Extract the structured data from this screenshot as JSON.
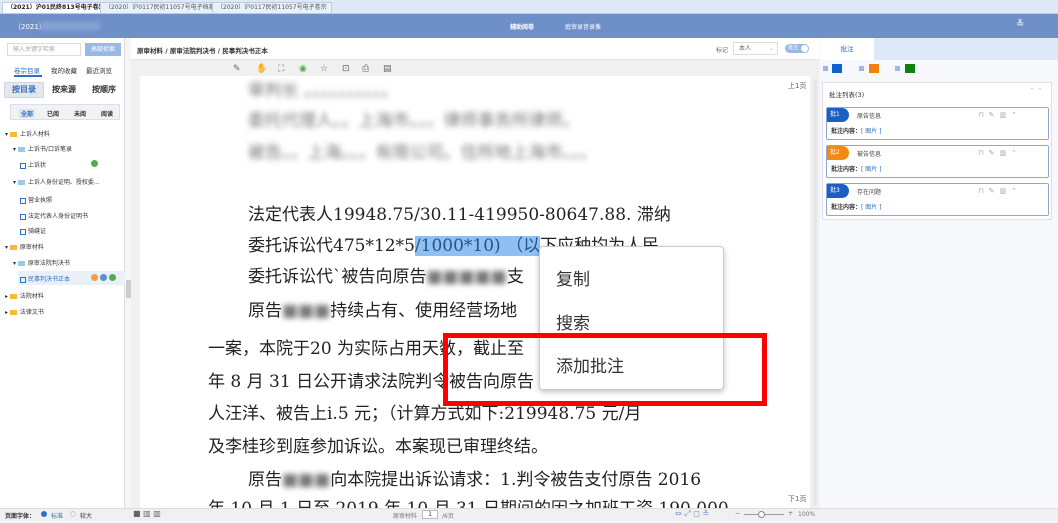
{
  "file_tabs": [
    "（2021）沪01民终813号电子卷宗",
    "（2020）沪0117民初11057号电子档案",
    "（2020）沪0117民初11057号电子卷宗"
  ],
  "header": {
    "case": "（2021）",
    "nav": [
      "辅助阅卷",
      "庭审录音录像"
    ]
  },
  "left": {
    "search_placeholder": "输入关键字检索",
    "search_button": "高级检索",
    "tabs": [
      "卷宗目录",
      "我的收藏",
      "最近浏览"
    ],
    "sort_tabs": [
      "按目录",
      "按来源",
      "按顺序"
    ],
    "filters": [
      "全部",
      "已阅",
      "未阅",
      "阅读"
    ],
    "tree": [
      {
        "label": "上诉人材料",
        "level": 0,
        "type": "folder"
      },
      {
        "label": "上诉书/口诉笔录",
        "level": 1,
        "type": "subfolder"
      },
      {
        "label": "上诉状",
        "level": 2,
        "type": "file"
      },
      {
        "label": "上诉人身份证明、授权委...",
        "level": 1,
        "type": "subfolder"
      },
      {
        "label": "营业执照",
        "level": 2,
        "type": "file"
      },
      {
        "label": "法定代表人身份证明书",
        "level": 2,
        "type": "file"
      },
      {
        "label": "骑缝证",
        "level": 2,
        "type": "file"
      },
      {
        "label": "原审材料",
        "level": 0,
        "type": "folder"
      },
      {
        "label": "原审法院判决书",
        "level": 1,
        "type": "subfolder"
      },
      {
        "label": "民事判决书正本",
        "level": 2,
        "type": "file"
      },
      {
        "label": "法院材料",
        "level": 0,
        "type": "folder"
      },
      {
        "label": "法律文书",
        "level": 0,
        "type": "folder"
      }
    ]
  },
  "doc": {
    "breadcrumb": "原审材料 / 原审法院判决书 / 民事判决书正本",
    "mark_label": "标记",
    "mark_select": "本人",
    "toggle_label": "批注",
    "prev_page": "上1页",
    "next_page": "下1页",
    "lines": {
      "b1": "审判长 。。。。。。。。。。",
      "b2": "委托代理人。。上海市。。。律师事务所律师。",
      "b3": "被告。。上海。。。有限公司。住所地上海市。。。",
      "l1": "法定代表人19948.75/30.11-419950-80647.88. 滞纳",
      "l2a": "委托诉讼代475*12*5",
      "l2h": "/1000*10) （以",
      "l2b": "下应种均为人民",
      "l3a": "委托诉讼代`被告向原告",
      "l3b": "支",
      "l4a": "原告",
      "l4b": "持续占有、使用经营场地",
      "l5": "一案，本院于20 为实际占用天数，截止至",
      "l6": "年 8 月 31 日公开请求法院判令被告向原告",
      "l7": "人汪洋、被告上i.5 元；（计算方式如下:219948.75 元/月",
      "l8": "及李桂珍到庭参加诉讼。本案现已审理终结。",
      "l9a": "原告",
      "l9b": "向本院提出诉讼请求：1.判令被告支付原告 2016",
      "l10": "年 10 月 1 日至 2019 年 10 月 31 日期间的因之加班工资 190,000"
    }
  },
  "context_menu": [
    "复制",
    "搜索",
    "添加批注"
  ],
  "right": {
    "tab": "批注",
    "list_title": "批注列表(3)",
    "colors": [
      "#1060d0",
      "#f08010",
      "#108010"
    ],
    "annotations": [
      {
        "tag": "批1",
        "title": "原告信息",
        "content_label": "批注内容：",
        "content": "[ 图片 ]",
        "color": "#1b5fc4"
      },
      {
        "tag": "批2",
        "title": "被告信息",
        "content_label": "批注内容：",
        "content": "[ 图片 ]",
        "color": "#f08a10"
      },
      {
        "tag": "批3",
        "title": "存在问题",
        "content_label": "批注内容：",
        "content": "[ 图片 ]",
        "color": "#1b5fc4"
      }
    ]
  },
  "bottom": {
    "font_label": "页面字体：",
    "font_options": [
      "标准",
      "较大"
    ],
    "page_label": "原审材料",
    "page": "1",
    "total": "/6页",
    "zoom": "100%"
  }
}
